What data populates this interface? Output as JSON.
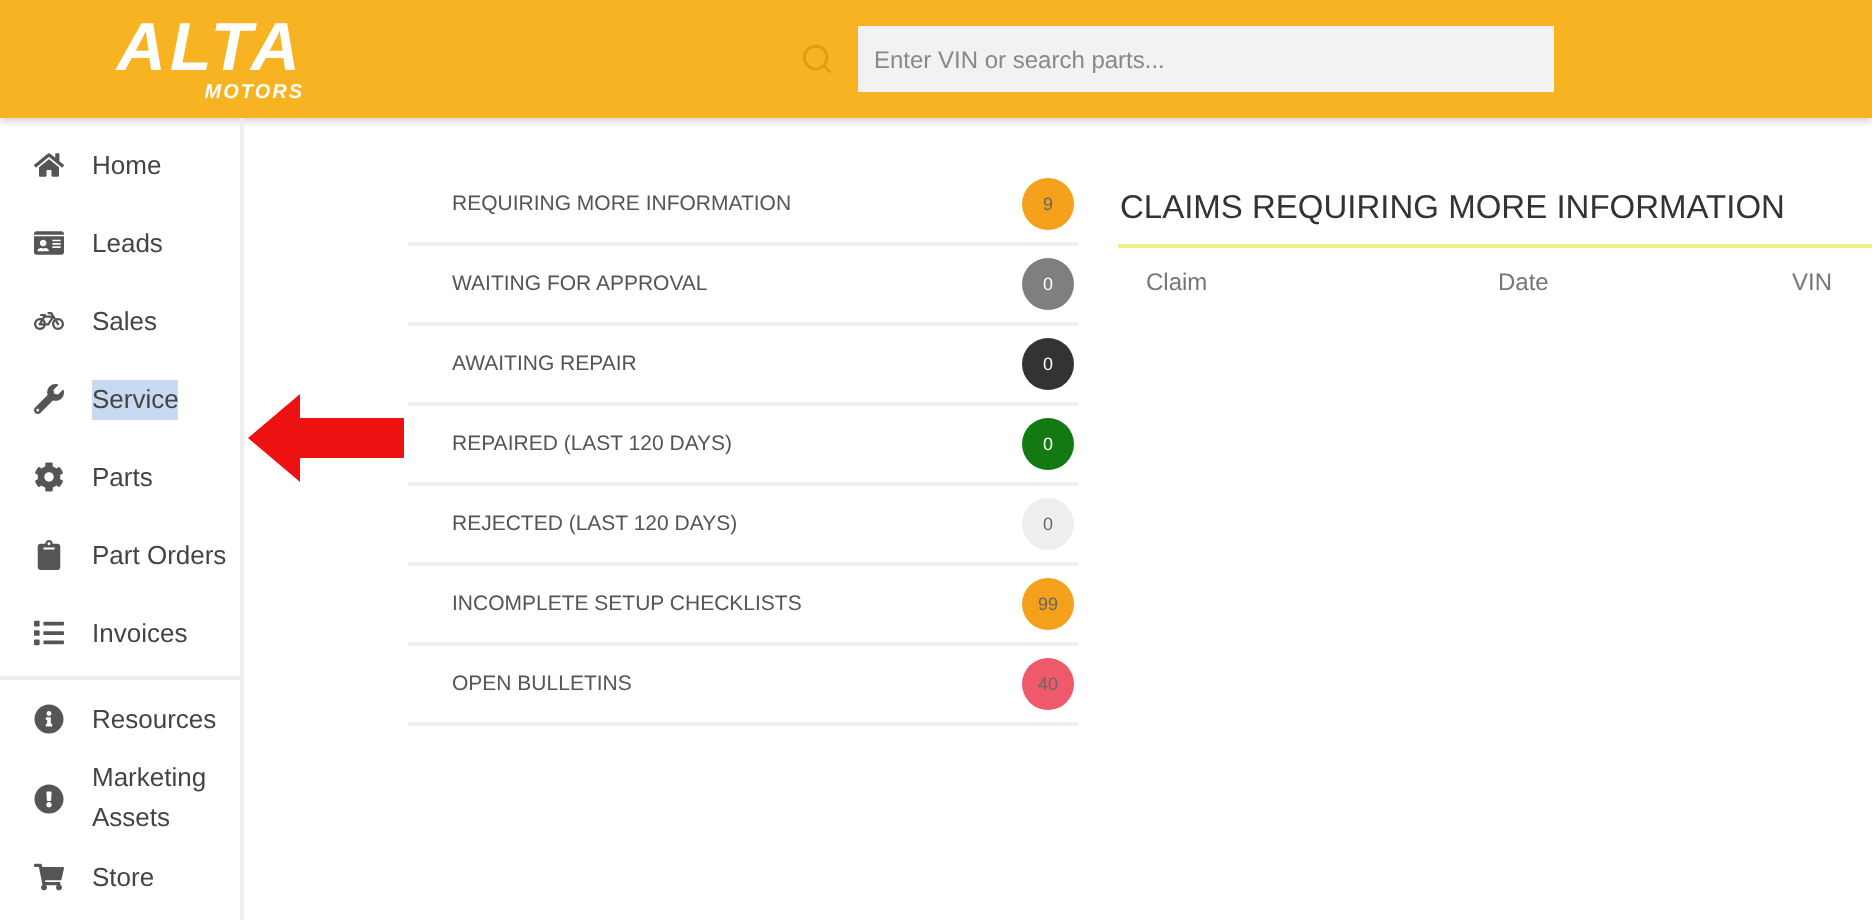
{
  "header": {
    "logo_title": "ALTA",
    "logo_subtitle": "MOTORS",
    "search": {
      "placeholder": "Enter VIN or search parts..."
    }
  },
  "sidebar": {
    "groups": [
      {
        "items": [
          {
            "label": "Home",
            "kind": "home",
            "selected": false
          },
          {
            "label": "Leads",
            "kind": "leads",
            "selected": false
          },
          {
            "label": "Sales",
            "kind": "sales",
            "selected": false
          },
          {
            "label": "Service",
            "kind": "service",
            "selected": true
          },
          {
            "label": "Parts",
            "kind": "parts",
            "selected": false
          },
          {
            "label": "Part Orders",
            "kind": "orders",
            "selected": false
          },
          {
            "label": "Invoices",
            "kind": "invoices",
            "selected": false
          }
        ]
      },
      {
        "items": [
          {
            "label": "Resources",
            "kind": "info",
            "selected": false
          },
          {
            "label": "Marketing Assets",
            "kind": "alert",
            "selected": false
          },
          {
            "label": "Store",
            "kind": "cart",
            "selected": false
          }
        ]
      }
    ]
  },
  "annotation": {
    "kind": "arrow",
    "color": "#ee1111"
  },
  "status_list": [
    {
      "label": "REQUIRING MORE INFORMATION",
      "count": "9",
      "color": "#f5a01a"
    },
    {
      "label": "WAITING FOR APPROVAL",
      "count": "0",
      "color": "#7f7f7f"
    },
    {
      "label": "AWAITING REPAIR",
      "count": "0",
      "color": "#333333"
    },
    {
      "label": "REPAIRED (LAST 120 DAYS)",
      "count": "0",
      "color": "#137a13"
    },
    {
      "label": "REJECTED (LAST 120 DAYS)",
      "count": "0",
      "color": "#eeeeee"
    },
    {
      "label": "INCOMPLETE SETUP CHECKLISTS",
      "count": "99",
      "color": "#f5a01a"
    },
    {
      "label": "OPEN BULLETINS",
      "count": "40",
      "color": "#ef5a6a"
    }
  ],
  "claims_panel": {
    "title": "CLAIMS REQUIRING MORE INFORMATION",
    "columns": [
      "Claim",
      "Date",
      "VIN"
    ]
  }
}
